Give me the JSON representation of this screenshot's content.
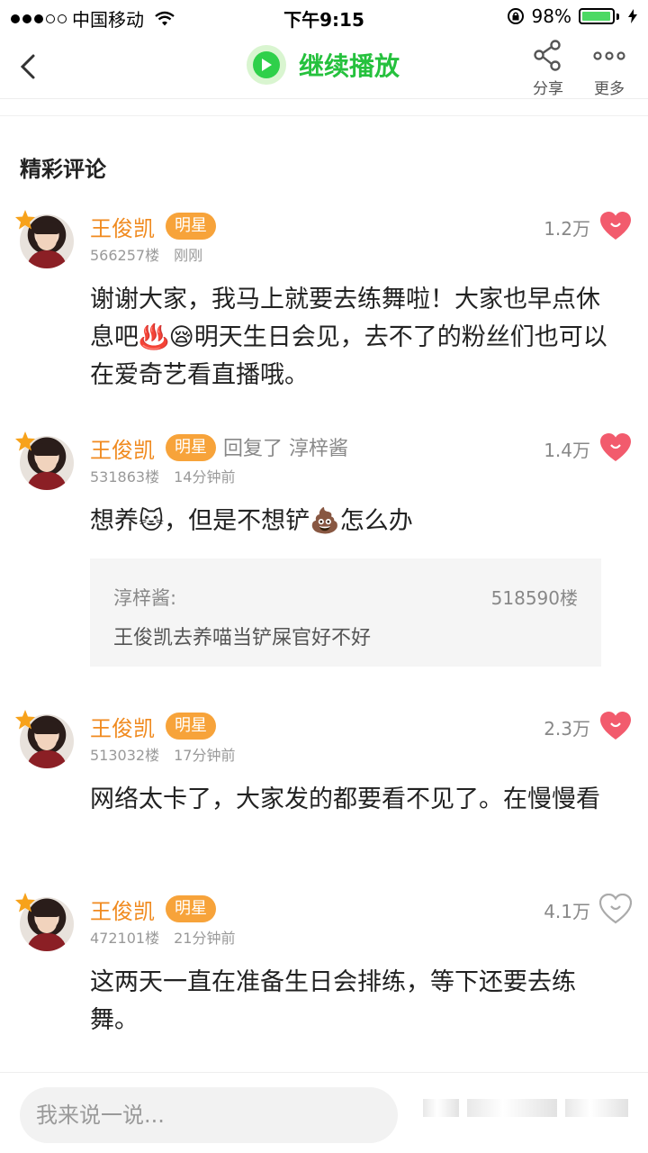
{
  "status_bar": {
    "carrier": "中国移动",
    "time": "下午9:15",
    "battery": "98%",
    "battery_level": 0.98,
    "colors": {
      "battery_fill": "#4cd964"
    }
  },
  "nav": {
    "continue_label": "继续播放",
    "share_label": "分享",
    "more_label": "更多",
    "accent": "#25c13d"
  },
  "section_title": "精彩评论",
  "comments": [
    {
      "user": "王俊凯",
      "badge": "明星",
      "floor": "566257楼",
      "time": "刚刚",
      "likes": "1.2万",
      "liked": true,
      "text": "谢谢大家，我马上就要去练舞啦！大家也早点休息吧♨️😪明天生日会见，去不了的粉丝们也可以在爱奇艺看直播哦。"
    },
    {
      "user": "王俊凯",
      "badge": "明星",
      "reply_label": "回复了 淳梓酱",
      "floor": "531863楼",
      "time": "14分钟前",
      "likes": "1.4万",
      "liked": true,
      "text": "想养🐱，但是不想铲💩怎么办",
      "quote": {
        "user": "淳梓酱:",
        "floor": "518590楼",
        "text": "王俊凯去养喵当铲屎官好不好"
      }
    },
    {
      "user": "王俊凯",
      "badge": "明星",
      "floor": "513032楼",
      "time": "17分钟前",
      "likes": "2.3万",
      "liked": true,
      "text": "网络太卡了，大家发的都要看不见了。在慢慢看"
    },
    {
      "user": "王俊凯",
      "badge": "明星",
      "floor": "472101楼",
      "time": "21分钟前",
      "likes": "4.1万",
      "liked": false,
      "text": "这两天一直在准备生日会排练，等下还要去练舞。"
    }
  ],
  "bottom": {
    "input_placeholder": "我来说一说..."
  },
  "icons": [
    "back-icon",
    "play-icon",
    "share-icon",
    "more-icon",
    "heart-icon",
    "star-icon",
    "wifi-icon",
    "lock-rotation-icon",
    "battery-icon",
    "charging-bolt-icon"
  ]
}
